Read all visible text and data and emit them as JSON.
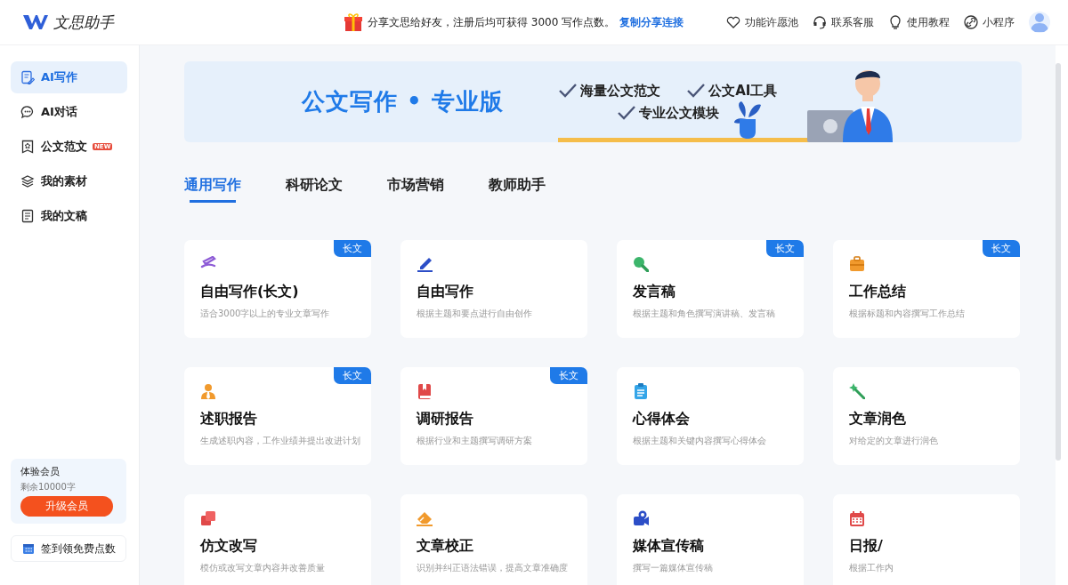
{
  "header": {
    "logo": "文思助手",
    "promo": {
      "text": "分享文思给好友，注册后均可获得 3000 写作点数。",
      "link": "复制分享连接"
    },
    "nav": [
      {
        "kind": "heart",
        "label": "功能许愿池"
      },
      {
        "kind": "headset",
        "label": "联系客服"
      },
      {
        "kind": "bulb",
        "label": "使用教程"
      },
      {
        "kind": "link",
        "label": "小程序"
      }
    ]
  },
  "sidebar": {
    "items": [
      {
        "kind": "write",
        "label": "AI写作",
        "selected": true
      },
      {
        "kind": "chat",
        "label": "AI对话",
        "selected": false
      },
      {
        "kind": "sample",
        "label": "公文范文",
        "selected": false,
        "badge": "NEW"
      },
      {
        "kind": "layers",
        "label": "我的素材",
        "selected": false
      },
      {
        "kind": "doc",
        "label": "我的文稿",
        "selected": false
      }
    ],
    "membership": {
      "title": "体验会员",
      "remaining": "剩余10000字",
      "button": "升级会员"
    },
    "checkin": "签到领免费点数"
  },
  "banner": {
    "title": "公文写作 • 专业版",
    "features": [
      "海量公文范文",
      "公文AI工具",
      "专业公文模块"
    ]
  },
  "tabs": [
    {
      "label": "通用写作",
      "selected": true
    },
    {
      "label": "科研论文",
      "selected": false
    },
    {
      "label": "市场营销",
      "selected": false
    },
    {
      "label": "教师助手",
      "selected": false
    }
  ],
  "cards": [
    {
      "title": "自由写作(长文)",
      "desc": "适合3000字以上的专业文章写作",
      "badge": "长文"
    },
    {
      "title": "自由写作",
      "desc": "根据主题和要点进行自由创作"
    },
    {
      "title": "发言稿",
      "desc": "根据主题和角色撰写演讲稿、发言稿",
      "badge": "长文"
    },
    {
      "title": "工作总结",
      "desc": "根据标题和内容撰写工作总结",
      "badge": "长文"
    },
    {
      "title": "述职报告",
      "desc": "生成述职内容，工作业绩并提出改进计划",
      "badge": "长文"
    },
    {
      "title": "调研报告",
      "desc": "根据行业和主题撰写调研方案",
      "badge": "长文"
    },
    {
      "title": "心得体会",
      "desc": "根据主题和关键内容撰写心得体会"
    },
    {
      "title": "文章润色",
      "desc": "对给定的文章进行润色"
    },
    {
      "title": "仿文改写",
      "desc": "模仿或改写文章内容并改善质量"
    },
    {
      "title": "文章校正",
      "desc": "识别并纠正语法错误，提高文章准确度"
    },
    {
      "title": "媒体宣传稿",
      "desc": "撰写一篇媒体宣传稿"
    },
    {
      "title": "日报/",
      "desc": "根据工作内"
    }
  ]
}
